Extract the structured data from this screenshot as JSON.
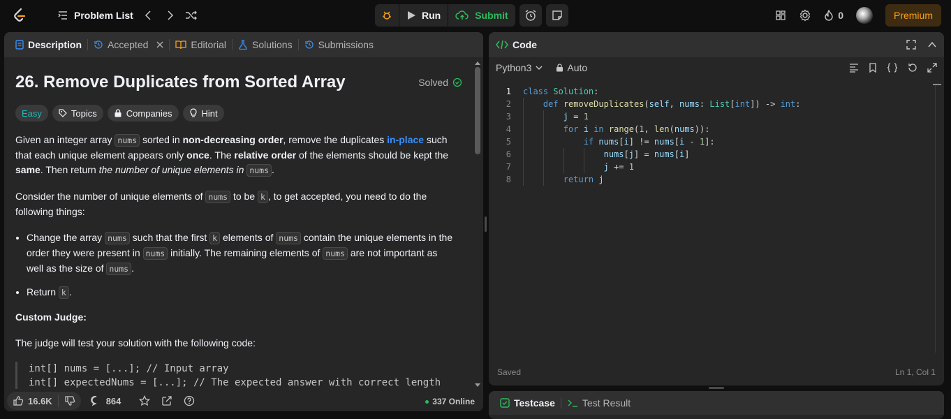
{
  "topbar": {
    "title": "Problem List",
    "run": "Run",
    "submit": "Submit",
    "streak": "0",
    "premium": "Premium"
  },
  "left_tabs": [
    "Description",
    "Accepted",
    "Editorial",
    "Solutions",
    "Submissions"
  ],
  "problem": {
    "title": "26. Remove Duplicates from Sorted Array",
    "solved": "Solved",
    "chips": [
      "Easy",
      "Topics",
      "Companies",
      "Hint"
    ],
    "p1": {
      "a": "Given an integer array ",
      "code": "nums",
      "b": " sorted in ",
      "bold1": "non-decreasing order",
      "c": ", remove the duplicates ",
      "blue": "in-place",
      "d": " such that each unique element appears only ",
      "bold2": "once",
      "e": ". The ",
      "bold3": "relative order",
      "f": " of the elements should be kept the ",
      "bold4": "same",
      "g": ". Then return ",
      "i": "the number of unique elements in ",
      "code2": "nums",
      "h": "."
    },
    "p2": {
      "a": "Consider the number of unique elements of ",
      "code": "nums",
      "b": " to be ",
      "k": "k",
      "c": ", to get accepted, you need to do the following things:"
    },
    "li1": {
      "a": "Change the array ",
      "code": "nums",
      "b": " such that the first ",
      "k": "k",
      "c": " elements of ",
      "code2": "nums",
      "d": " contain the unique elements in the order they were present in ",
      "code3": "nums",
      "e": " initially. The remaining elements of ",
      "code4": "nums",
      "f": " are not important as well as the size of ",
      "code5": "nums",
      "g": "."
    },
    "li2": {
      "a": "Return ",
      "k": "k",
      "b": "."
    },
    "judge_heading": "Custom Judge:",
    "judge_text": "The judge will test your solution with the following code:",
    "judge_code": [
      "int[] nums = [...]; // Input array",
      "int[] expectedNums = [...]; // The expected answer with correct length"
    ]
  },
  "footer": {
    "likes": "16.6K",
    "comments": "864",
    "online": "337 Online"
  },
  "code_panel": {
    "title": "Code",
    "language": "Python3",
    "mode": "Auto",
    "status": "Saved",
    "position": "Ln 1, Col 1"
  },
  "code_lines": [
    "1",
    "2",
    "3",
    "4",
    "5",
    "6",
    "7",
    "8"
  ],
  "bottom_tabs": [
    "Testcase",
    "Test Result"
  ]
}
